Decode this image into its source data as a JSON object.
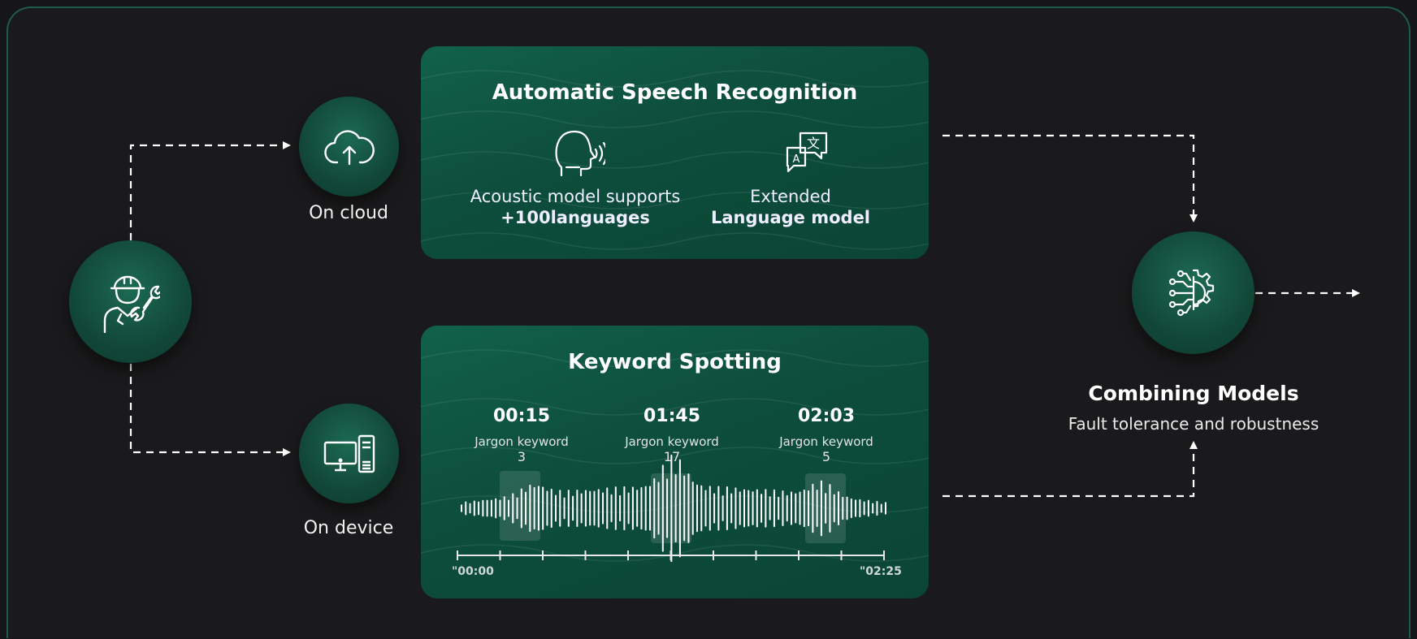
{
  "engineer": {
    "icon": "engineer-wrench-icon"
  },
  "cloud": {
    "label": "On cloud",
    "icon": "cloud-upload-icon"
  },
  "device": {
    "label": "On device",
    "icon": "desktop-computer-icon"
  },
  "asr": {
    "title": "Automatic Speech Recognition",
    "acoustic": {
      "icon": "speaking-head-icon",
      "line1": "Acoustic model supports",
      "line2": "+100languages"
    },
    "language": {
      "icon": "translate-icon",
      "line1": "Extended",
      "line2": "Language model"
    }
  },
  "kws": {
    "title": "Keyword Spotting",
    "keywords": [
      {
        "time": "00:15",
        "label": "Jargon keyword",
        "count": "3"
      },
      {
        "time": "01:45",
        "label": "Jargon keyword",
        "count": "17"
      },
      {
        "time": "02:03",
        "label": "Jargon keyword",
        "count": "5"
      }
    ],
    "start": "\"00:00",
    "end": "\"02:25"
  },
  "combine": {
    "icon": "gear-circuit-icon",
    "title": "Combining Models",
    "subtitle": "Fault tolerance and robustness"
  },
  "colors": {
    "accent": "#124838",
    "background": "#1a1a1c",
    "border": "#1d5c49"
  }
}
